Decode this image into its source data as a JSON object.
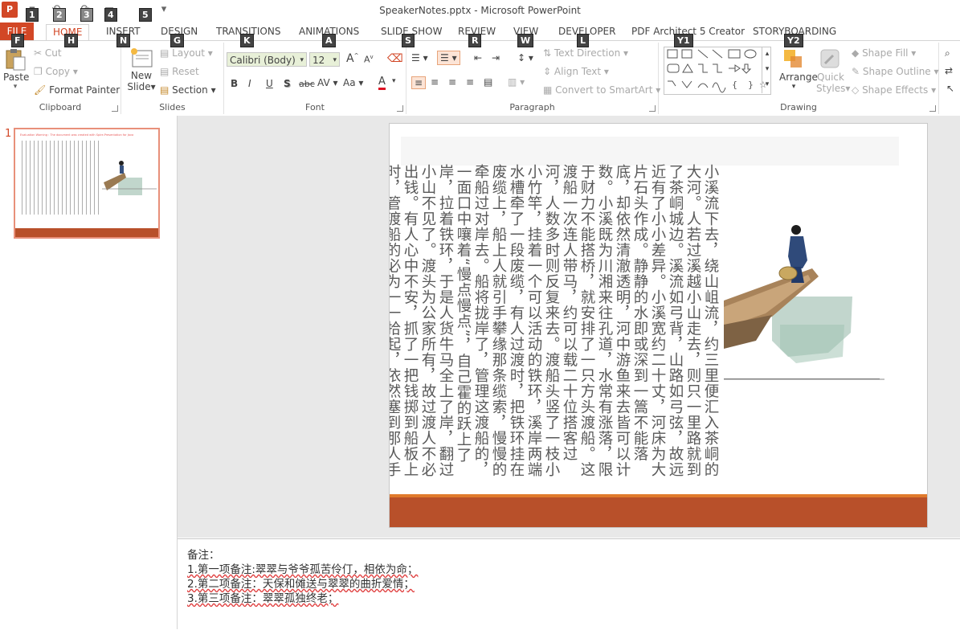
{
  "window": {
    "title": "SpeakerNotes.pptx - Microsoft PowerPoint"
  },
  "keytips": {
    "qat": [
      "1",
      "2",
      "3",
      "4",
      "5"
    ],
    "tabs": [
      "F",
      "H",
      "N",
      "G",
      "K",
      "A",
      "S",
      "R",
      "W",
      "L",
      "Y1",
      "Y2"
    ]
  },
  "tabs": [
    "FILE",
    "HOME",
    "INSERT",
    "DESIGN",
    "TRANSITIONS",
    "ANIMATIONS",
    "SLIDE SHOW",
    "REVIEW",
    "VIEW",
    "DEVELOPER",
    "PDF Architect 5 Creator",
    "STORYBOARDING"
  ],
  "clipboard": {
    "label": "Clipboard",
    "paste": "Paste",
    "cut": "Cut",
    "copy": "Copy",
    "format_painter": "Format Painter"
  },
  "slides": {
    "label": "Slides",
    "new_slide_1": "New",
    "new_slide_2": "Slide",
    "layout": "Layout",
    "reset": "Reset",
    "section": "Section"
  },
  "font": {
    "label": "Font",
    "name": "Calibri (Body)",
    "size": "12"
  },
  "paragraph": {
    "label": "Paragraph",
    "text_direction": "Text Direction",
    "align_text": "Align Text",
    "convert_smartart": "Convert to SmartArt"
  },
  "drawing": {
    "label": "Drawing",
    "arrange": "Arrange",
    "quick_1": "Quick",
    "quick_2": "Styles",
    "shape_fill": "Shape Fill",
    "shape_outline": "Shape Outline",
    "shape_effects": "Shape Effects"
  },
  "thumb": {
    "number": "1",
    "title": "Evaluation Warning : The document was created with Spire.Presentation for Java"
  },
  "slide": {
    "body_text": "小溪流下去，绕山岨流，约三里便汇入茶峒的大河。人若过溪越小山走去，则只一里路就到了茶峒城边。溪流如弓背，山路如弓弦，故远近有了小小差异。小溪宽约二十丈，河床为大片石头作成。静静的水即或深到一篙不能落底，却依然清澈透明，河中游鱼来去皆可以计数。小溪既为川湘来往孔道，水常有涨落，限于财力不能搭桥，就安排了一只方头渡船。这渡船一次连人带马，约可以载二十位搭客过河，人数多时则反复来去。渡船头竖了一枝小小竹竿，挂着一个可以活动的铁环，溪岸两端水槽牵了一段废缆，有人过渡时，把铁环挂在废缆上，船上人就引手攀缘那条缆索，慢慢的牵船过对岸去。船将拢岸了，管理这渡船的，一面口中嚷着“慢点慢点”，自己霍的跃上了岸，拉着铁环，于是人货牛马全上了岸，翻过小山不见了。渡头为公家所有，故过渡人不必出钱。有人心中不安，抓了一把钱掷到船板上时，管渡船的必为一一拾起，依然塞到那人手心里去，俨然吵嘴时的认真神气：“我有了口量，三斗米，七百钱，够了。谁要这个！”"
  },
  "notes": {
    "heading": "备注：",
    "lines": [
      "1.第一项备注:翠翠与爷爷孤苦伶仃，相依为命；",
      "2.第二项备注：天保和傩送与翠翠的曲折爱情；",
      "3.第三项备注：翠翠孤独终老；"
    ]
  },
  "colors": {
    "accent": "#d24726",
    "slide_footer": "#b8502a",
    "slide_footer_line": "#e07a2c"
  }
}
